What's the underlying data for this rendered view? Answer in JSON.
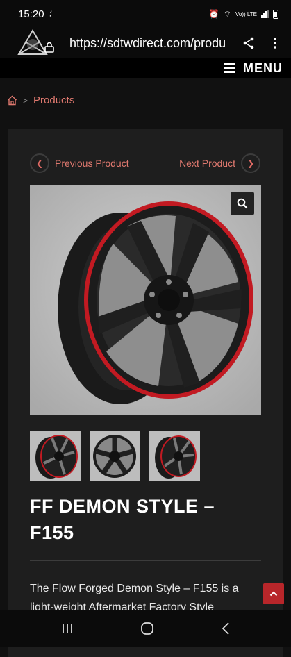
{
  "status_bar": {
    "time": "15:20",
    "mini_text": "tiktok",
    "network": "Vo)) LTE"
  },
  "browser": {
    "url": "https://sdtwdirect.com/produ"
  },
  "site_header": {
    "menu_label": "MENU"
  },
  "breadcrumb": {
    "current": "Products"
  },
  "product_nav": {
    "previous_label": "Previous Product",
    "next_label": "Next Product"
  },
  "product": {
    "title": "FF DEMON STYLE – F155",
    "description": "The Flow Forged Demon Style – F155 is a light-weight Aftermarket Factory Style",
    "thumbnails": [
      "thumb-1",
      "thumb-2",
      "thumb-3"
    ]
  },
  "colors": {
    "accent": "#e0796f",
    "card_bg": "#1e1e1e",
    "page_bg": "#111111",
    "scroll_btn": "#b8262a",
    "wheel_lip": "#c21a22"
  }
}
